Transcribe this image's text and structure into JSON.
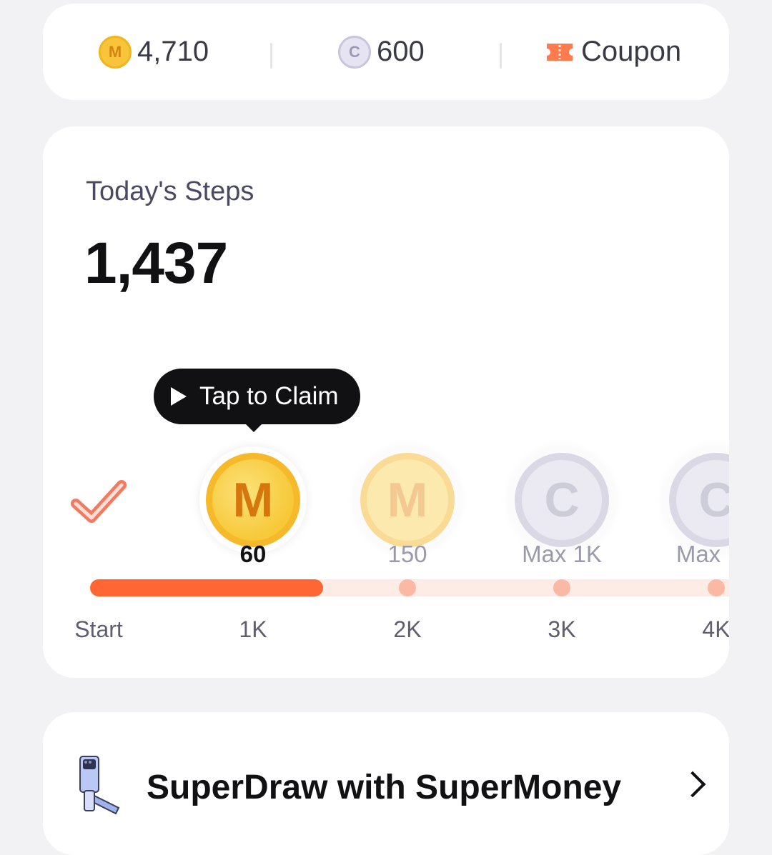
{
  "balances": {
    "m_coins": "4,710",
    "m_coin_icon": "M",
    "c_coins": "600",
    "c_coin_icon": "C",
    "coupon_label": "Coupon"
  },
  "steps": {
    "title": "Today's Steps",
    "count": "1,437",
    "progress_fraction": 0.37,
    "tooltip": "Tap to Claim",
    "rewards": [
      {
        "icon": "M",
        "label": "60",
        "state": "claimable"
      },
      {
        "icon": "M",
        "label": "150",
        "state": "locked"
      },
      {
        "icon": "C",
        "label": "Max 1K",
        "state": "locked"
      },
      {
        "icon": "C",
        "label": "Max",
        "state": "locked"
      }
    ],
    "milestones": [
      "Start",
      "1K",
      "2K",
      "3K",
      "4K"
    ]
  },
  "superdraw": {
    "title": "SuperDraw with SuperMoney"
  },
  "colors": {
    "accent": "#FF6633",
    "gold": "#F7C838",
    "background": "#F2F2F5"
  }
}
